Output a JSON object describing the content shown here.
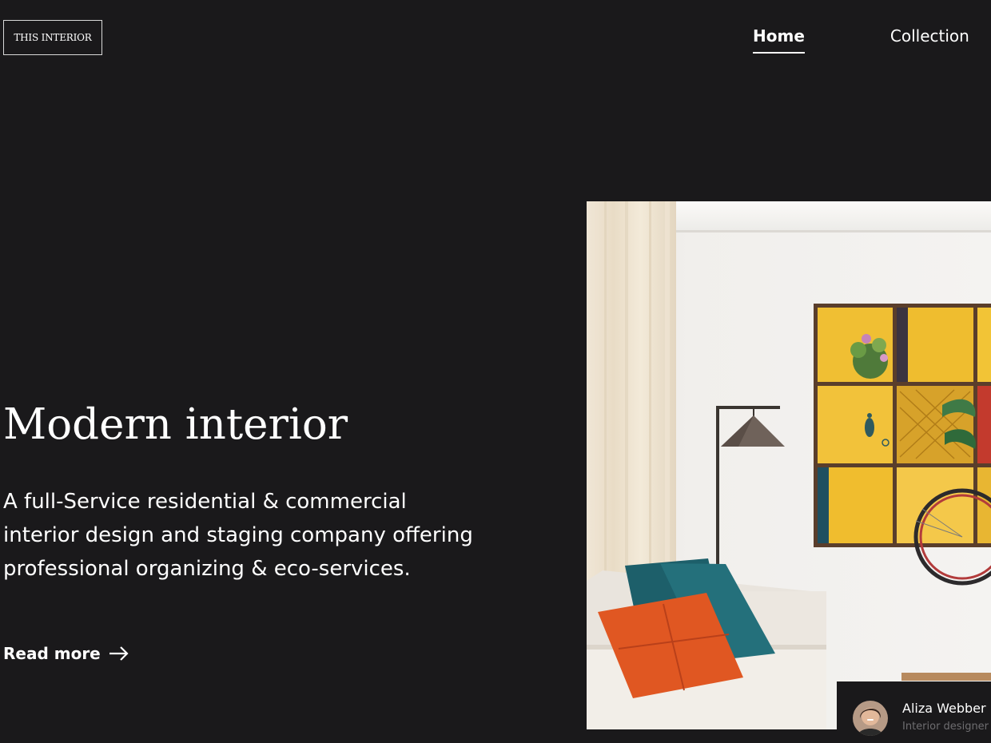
{
  "brand": {
    "logo_text": "THIS INTERIOR"
  },
  "nav": {
    "items": [
      {
        "label": "Home",
        "active": true
      },
      {
        "label": "Collection",
        "active": false
      }
    ]
  },
  "hero": {
    "title": "Modern interior",
    "description": "A full-Service residential & commercial interior design and staging company offering professional organizing & eco-services.",
    "read_more_label": "Read more",
    "read_more_icon": "arrow-right-icon",
    "image_alt": "Living room with lamp, cushions and yellow wall art"
  },
  "designer": {
    "name": "Aliza Webber",
    "role": "Interior designer",
    "avatar_icon": "avatar"
  },
  "colors": {
    "background": "#1a191b",
    "text": "#ffffff",
    "muted_text": "#6e6d70",
    "accent_yellow": "#f1c232",
    "accent_orange": "#e0531e",
    "accent_teal": "#1f6b73"
  }
}
